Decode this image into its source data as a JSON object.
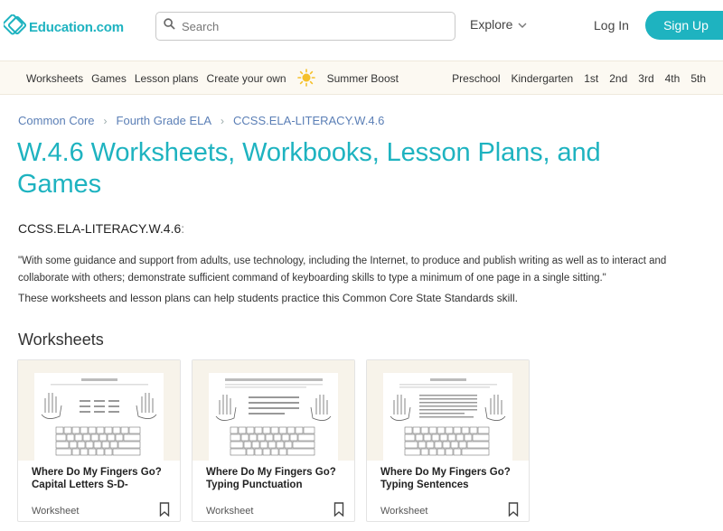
{
  "header": {
    "logo_text": "Education.com",
    "search_placeholder": "Search",
    "explore_label": "Explore",
    "login_label": "Log In",
    "signup_label": "Sign Up"
  },
  "subnav": {
    "left_items": [
      "Worksheets",
      "Games",
      "Lesson plans",
      "Create your own"
    ],
    "summer_boost": "Summer Boost",
    "grades": [
      "Preschool",
      "Kindergarten",
      "1st",
      "2nd",
      "3rd",
      "4th",
      "5th"
    ]
  },
  "breadcrumb": [
    "Common Core",
    "Fourth Grade ELA",
    "CCSS.ELA-LITERACY.W.4.6"
  ],
  "page": {
    "title": "W.4.6 Worksheets, Workbooks, Lesson Plans, and Games",
    "standard_code": "CCSS.ELA-LITERACY.W.4.6",
    "standard_colon": ":",
    "standard_text": "\"With some guidance and support from adults, use technology, including the Internet, to produce and publish writing as well as to interact and collaborate with others; demonstrate sufficient command of keyboarding skills to type a minimum of one page in a single sitting.\"",
    "description": "These worksheets and lesson plans can help students practice this Common Core State Standards skill.",
    "section_title": "Worksheets"
  },
  "cards": [
    {
      "title": "Where Do My Fingers Go? Capital Letters S-D-",
      "type": "Worksheet"
    },
    {
      "title": "Where Do My Fingers Go? Typing Punctuation",
      "type": "Worksheet"
    },
    {
      "title": "Where Do My Fingers Go? Typing Sentences",
      "type": "Worksheet"
    }
  ],
  "colors": {
    "brand": "#1eb3c0",
    "link": "#5b7fb6",
    "subnav_bg": "#fcf9f2"
  },
  "icons": {
    "logo": "education-logo-icon",
    "search": "search-icon",
    "explore": "chevron-down-icon",
    "summer": "sun-icon",
    "bookmark": "bookmark-icon"
  }
}
